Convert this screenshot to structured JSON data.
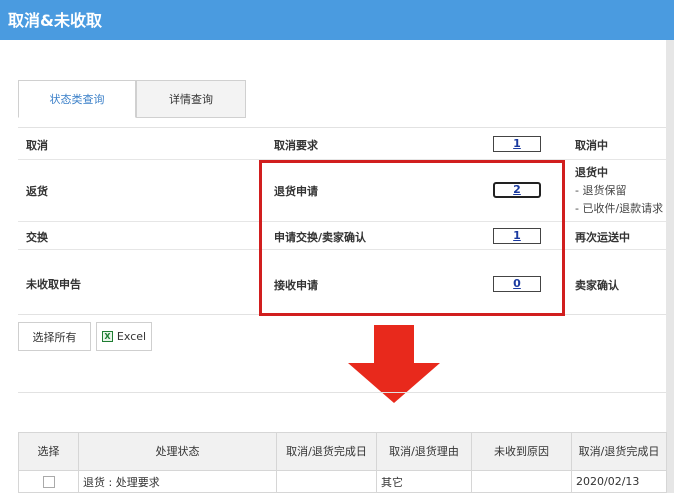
{
  "header": {
    "title": "取消&未收取"
  },
  "tabs": [
    {
      "label": "状态类查询",
      "active": true
    },
    {
      "label": "详情查询",
      "active": false
    }
  ],
  "status_rows": [
    {
      "category": "取消",
      "action": "取消要求",
      "count": "1",
      "status": "取消中",
      "sub_items": []
    },
    {
      "category": "返货",
      "action": "退货申请",
      "count": "2",
      "status": "退货中",
      "sub_items": [
        "- 退货保留",
        "- 已收件/退款请求"
      ]
    },
    {
      "category": "交换",
      "action": "申请交换/卖家确认",
      "count": "1",
      "status": "再次运送中",
      "sub_items": []
    },
    {
      "category": "未收取申告",
      "action": "接收申请",
      "count": "0",
      "status": "卖家确认",
      "sub_items": []
    }
  ],
  "buttons": {
    "select_all": "选择所有",
    "excel": "Excel"
  },
  "icons": {
    "excel": "excel-icon",
    "arrow": "down-arrow-icon"
  },
  "colors": {
    "header": "#4a9be0",
    "highlight": "#d11e1e",
    "arrow": "#e8291c",
    "link": "#1a3aa0"
  },
  "result_table": {
    "headers": [
      "选择",
      "处理状态",
      "取消/退货完成日",
      "取消/退货理由",
      "未收到原因",
      "取消/退货完成日"
    ],
    "rows": [
      {
        "status": "退货 : 处理要求",
        "completed": "",
        "reason": "其它",
        "not_received": "",
        "completed2": "2020/02/13"
      }
    ]
  }
}
